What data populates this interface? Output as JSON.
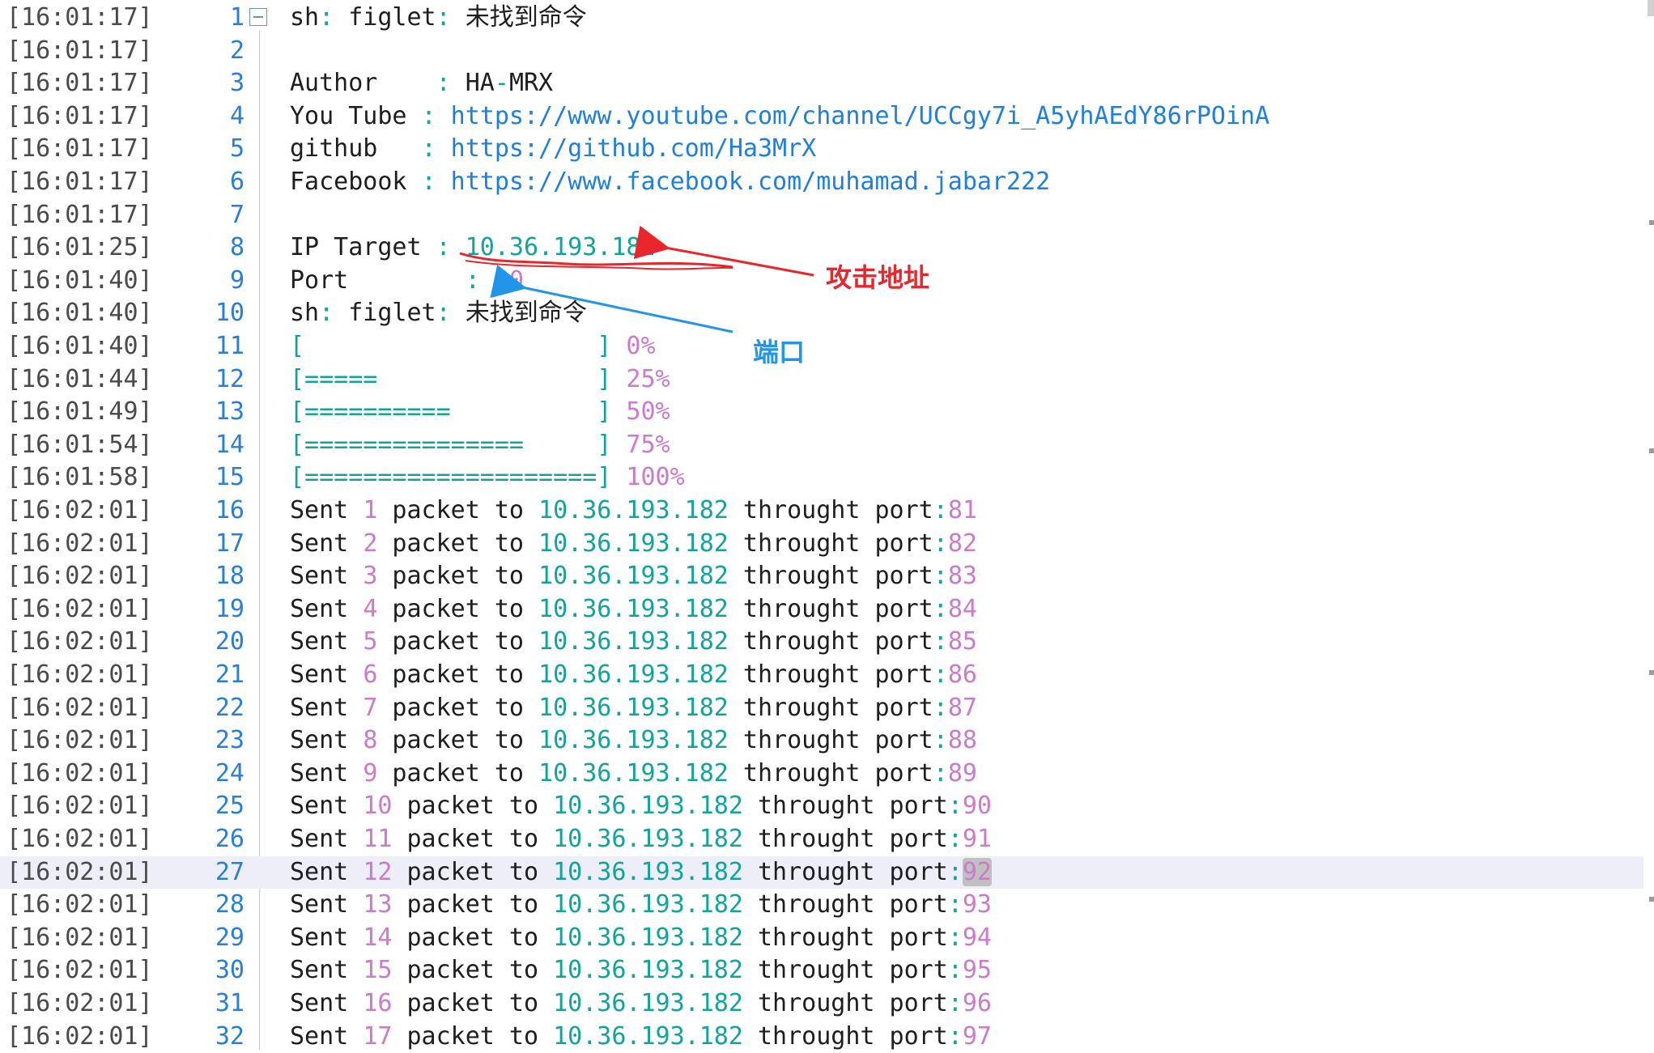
{
  "editor": {
    "lines": [
      {
        "ts": "[16:01:17]",
        "no": "1",
        "parts": [
          {
            "t": "sh",
            "c": ""
          },
          {
            "t": ":",
            "c": "punct"
          },
          {
            "t": " figlet",
            "c": ""
          },
          {
            "t": ":",
            "c": "punct"
          },
          {
            "t": " 未找到命令",
            "c": ""
          }
        ]
      },
      {
        "ts": "[16:01:17]",
        "no": "2",
        "parts": []
      },
      {
        "ts": "[16:01:17]",
        "no": "3",
        "parts": [
          {
            "t": "Author   ",
            "c": ""
          },
          {
            "t": " :",
            "c": "punct"
          },
          {
            "t": " HA",
            "c": ""
          },
          {
            "t": "-",
            "c": "punct"
          },
          {
            "t": "MRX",
            "c": ""
          }
        ]
      },
      {
        "ts": "[16:01:17]",
        "no": "4",
        "parts": [
          {
            "t": "You Tube ",
            "c": ""
          },
          {
            "t": ":",
            "c": "punct"
          },
          {
            "t": " https://www.youtube.com/channel/UCCgy7i_A5yhAEdY86rPOinA",
            "c": "link"
          }
        ]
      },
      {
        "ts": "[16:01:17]",
        "no": "5",
        "parts": [
          {
            "t": "github   ",
            "c": ""
          },
          {
            "t": ":",
            "c": "punct"
          },
          {
            "t": " https://github.com/Ha3MrX",
            "c": "link"
          }
        ]
      },
      {
        "ts": "[16:01:17]",
        "no": "6",
        "parts": [
          {
            "t": "Facebook ",
            "c": ""
          },
          {
            "t": ":",
            "c": "punct"
          },
          {
            "t": " https://www.facebook.com/muhamad.jabar222",
            "c": "link"
          }
        ]
      },
      {
        "ts": "[16:01:17]",
        "no": "7",
        "parts": []
      },
      {
        "ts": "[16:01:25]",
        "no": "8",
        "parts": [
          {
            "t": "IP Target ",
            "c": ""
          },
          {
            "t": ":",
            "c": "punct"
          },
          {
            "t": " 10.36.193.182",
            "c": "ip"
          }
        ]
      },
      {
        "ts": "[16:01:40]",
        "no": "9",
        "parts": [
          {
            "t": "Port        ",
            "c": ""
          },
          {
            "t": ":",
            "c": "punct"
          },
          {
            "t": " 80",
            "c": "num"
          }
        ]
      },
      {
        "ts": "[16:01:40]",
        "no": "10",
        "parts": [
          {
            "t": "sh",
            "c": ""
          },
          {
            "t": ":",
            "c": "punct"
          },
          {
            "t": " figlet",
            "c": ""
          },
          {
            "t": ":",
            "c": "punct"
          },
          {
            "t": " 未找到命令",
            "c": ""
          }
        ]
      },
      {
        "ts": "[16:01:40]",
        "no": "11",
        "parts": [
          {
            "t": "[                    ]",
            "c": "bracket"
          },
          {
            "t": " 0%",
            "c": "num"
          }
        ]
      },
      {
        "ts": "[16:01:44]",
        "no": "12",
        "parts": [
          {
            "t": "[=====               ]",
            "c": "bracket"
          },
          {
            "t": " 25%",
            "c": "num"
          }
        ]
      },
      {
        "ts": "[16:01:49]",
        "no": "13",
        "parts": [
          {
            "t": "[==========          ]",
            "c": "bracket"
          },
          {
            "t": " 50%",
            "c": "num"
          }
        ]
      },
      {
        "ts": "[16:01:54]",
        "no": "14",
        "parts": [
          {
            "t": "[===============     ]",
            "c": "bracket"
          },
          {
            "t": " 75%",
            "c": "num"
          }
        ]
      },
      {
        "ts": "[16:01:58]",
        "no": "15",
        "parts": [
          {
            "t": "[====================]",
            "c": "bracket"
          },
          {
            "t": " 100%",
            "c": "num"
          }
        ]
      },
      {
        "ts": "[16:02:01]",
        "no": "16",
        "parts": [
          {
            "t": "Sent ",
            "c": ""
          },
          {
            "t": "1",
            "c": "num"
          },
          {
            "t": " packet to ",
            "c": ""
          },
          {
            "t": "10.36.193.182",
            "c": "ip"
          },
          {
            "t": " throught port",
            "c": ""
          },
          {
            "t": ":",
            "c": "punct"
          },
          {
            "t": "81",
            "c": "num"
          }
        ]
      },
      {
        "ts": "[16:02:01]",
        "no": "17",
        "parts": [
          {
            "t": "Sent ",
            "c": ""
          },
          {
            "t": "2",
            "c": "num"
          },
          {
            "t": " packet to ",
            "c": ""
          },
          {
            "t": "10.36.193.182",
            "c": "ip"
          },
          {
            "t": " throught port",
            "c": ""
          },
          {
            "t": ":",
            "c": "punct"
          },
          {
            "t": "82",
            "c": "num"
          }
        ]
      },
      {
        "ts": "[16:02:01]",
        "no": "18",
        "parts": [
          {
            "t": "Sent ",
            "c": ""
          },
          {
            "t": "3",
            "c": "num"
          },
          {
            "t": " packet to ",
            "c": ""
          },
          {
            "t": "10.36.193.182",
            "c": "ip"
          },
          {
            "t": " throught port",
            "c": ""
          },
          {
            "t": ":",
            "c": "punct"
          },
          {
            "t": "83",
            "c": "num"
          }
        ]
      },
      {
        "ts": "[16:02:01]",
        "no": "19",
        "parts": [
          {
            "t": "Sent ",
            "c": ""
          },
          {
            "t": "4",
            "c": "num"
          },
          {
            "t": " packet to ",
            "c": ""
          },
          {
            "t": "10.36.193.182",
            "c": "ip"
          },
          {
            "t": " throught port",
            "c": ""
          },
          {
            "t": ":",
            "c": "punct"
          },
          {
            "t": "84",
            "c": "num"
          }
        ]
      },
      {
        "ts": "[16:02:01]",
        "no": "20",
        "parts": [
          {
            "t": "Sent ",
            "c": ""
          },
          {
            "t": "5",
            "c": "num"
          },
          {
            "t": " packet to ",
            "c": ""
          },
          {
            "t": "10.36.193.182",
            "c": "ip"
          },
          {
            "t": " throught port",
            "c": ""
          },
          {
            "t": ":",
            "c": "punct"
          },
          {
            "t": "85",
            "c": "num"
          }
        ]
      },
      {
        "ts": "[16:02:01]",
        "no": "21",
        "parts": [
          {
            "t": "Sent ",
            "c": ""
          },
          {
            "t": "6",
            "c": "num"
          },
          {
            "t": " packet to ",
            "c": ""
          },
          {
            "t": "10.36.193.182",
            "c": "ip"
          },
          {
            "t": " throught port",
            "c": ""
          },
          {
            "t": ":",
            "c": "punct"
          },
          {
            "t": "86",
            "c": "num"
          }
        ]
      },
      {
        "ts": "[16:02:01]",
        "no": "22",
        "parts": [
          {
            "t": "Sent ",
            "c": ""
          },
          {
            "t": "7",
            "c": "num"
          },
          {
            "t": " packet to ",
            "c": ""
          },
          {
            "t": "10.36.193.182",
            "c": "ip"
          },
          {
            "t": " throught port",
            "c": ""
          },
          {
            "t": ":",
            "c": "punct"
          },
          {
            "t": "87",
            "c": "num"
          }
        ]
      },
      {
        "ts": "[16:02:01]",
        "no": "23",
        "parts": [
          {
            "t": "Sent ",
            "c": ""
          },
          {
            "t": "8",
            "c": "num"
          },
          {
            "t": " packet to ",
            "c": ""
          },
          {
            "t": "10.36.193.182",
            "c": "ip"
          },
          {
            "t": " throught port",
            "c": ""
          },
          {
            "t": ":",
            "c": "punct"
          },
          {
            "t": "88",
            "c": "num"
          }
        ]
      },
      {
        "ts": "[16:02:01]",
        "no": "24",
        "parts": [
          {
            "t": "Sent ",
            "c": ""
          },
          {
            "t": "9",
            "c": "num"
          },
          {
            "t": " packet to ",
            "c": ""
          },
          {
            "t": "10.36.193.182",
            "c": "ip"
          },
          {
            "t": " throught port",
            "c": ""
          },
          {
            "t": ":",
            "c": "punct"
          },
          {
            "t": "89",
            "c": "num"
          }
        ]
      },
      {
        "ts": "[16:02:01]",
        "no": "25",
        "parts": [
          {
            "t": "Sent ",
            "c": ""
          },
          {
            "t": "10",
            "c": "num"
          },
          {
            "t": " packet to ",
            "c": ""
          },
          {
            "t": "10.36.193.182",
            "c": "ip"
          },
          {
            "t": " throught port",
            "c": ""
          },
          {
            "t": ":",
            "c": "punct"
          },
          {
            "t": "90",
            "c": "num"
          }
        ]
      },
      {
        "ts": "[16:02:01]",
        "no": "26",
        "parts": [
          {
            "t": "Sent ",
            "c": ""
          },
          {
            "t": "11",
            "c": "num"
          },
          {
            "t": " packet to ",
            "c": ""
          },
          {
            "t": "10.36.193.182",
            "c": "ip"
          },
          {
            "t": " throught port",
            "c": ""
          },
          {
            "t": ":",
            "c": "punct"
          },
          {
            "t": "91",
            "c": "num"
          }
        ]
      },
      {
        "ts": "[16:02:01]",
        "no": "27",
        "current": true,
        "parts": [
          {
            "t": "Sent ",
            "c": ""
          },
          {
            "t": "12",
            "c": "num"
          },
          {
            "t": " packet to ",
            "c": ""
          },
          {
            "t": "10.36.193.182",
            "c": "ip"
          },
          {
            "t": " throught port",
            "c": ""
          },
          {
            "t": ":",
            "c": "punct"
          },
          {
            "t": "92",
            "c": "cursor"
          }
        ]
      },
      {
        "ts": "[16:02:01]",
        "no": "28",
        "parts": [
          {
            "t": "Sent ",
            "c": ""
          },
          {
            "t": "13",
            "c": "num"
          },
          {
            "t": " packet to ",
            "c": ""
          },
          {
            "t": "10.36.193.182",
            "c": "ip"
          },
          {
            "t": " throught port",
            "c": ""
          },
          {
            "t": ":",
            "c": "punct"
          },
          {
            "t": "93",
            "c": "num"
          }
        ]
      },
      {
        "ts": "[16:02:01]",
        "no": "29",
        "parts": [
          {
            "t": "Sent ",
            "c": ""
          },
          {
            "t": "14",
            "c": "num"
          },
          {
            "t": " packet to ",
            "c": ""
          },
          {
            "t": "10.36.193.182",
            "c": "ip"
          },
          {
            "t": " throught port",
            "c": ""
          },
          {
            "t": ":",
            "c": "punct"
          },
          {
            "t": "94",
            "c": "num"
          }
        ]
      },
      {
        "ts": "[16:02:01]",
        "no": "30",
        "parts": [
          {
            "t": "Sent ",
            "c": ""
          },
          {
            "t": "15",
            "c": "num"
          },
          {
            "t": " packet to ",
            "c": ""
          },
          {
            "t": "10.36.193.182",
            "c": "ip"
          },
          {
            "t": " throught port",
            "c": ""
          },
          {
            "t": ":",
            "c": "punct"
          },
          {
            "t": "95",
            "c": "num"
          }
        ]
      },
      {
        "ts": "[16:02:01]",
        "no": "31",
        "parts": [
          {
            "t": "Sent ",
            "c": ""
          },
          {
            "t": "16",
            "c": "num"
          },
          {
            "t": " packet to ",
            "c": ""
          },
          {
            "t": "10.36.193.182",
            "c": "ip"
          },
          {
            "t": " throught port",
            "c": ""
          },
          {
            "t": ":",
            "c": "punct"
          },
          {
            "t": "96",
            "c": "num"
          }
        ]
      },
      {
        "ts": "[16:02:01]",
        "no": "32",
        "parts": [
          {
            "t": "Sent ",
            "c": ""
          },
          {
            "t": "17",
            "c": "num"
          },
          {
            "t": " packet to ",
            "c": ""
          },
          {
            "t": "10.36.193.182",
            "c": "ip"
          },
          {
            "t": " throught port",
            "c": ""
          },
          {
            "t": ":",
            "c": "punct"
          },
          {
            "t": "97",
            "c": "num"
          }
        ]
      }
    ]
  },
  "annotations": {
    "attack_label": "攻击地址",
    "port_label": "端口",
    "attack_color": "#e8262c",
    "port_color": "#2196e8"
  },
  "colors": {
    "link": "#1e7fdc",
    "ip": "#14a39a",
    "number": "#cc7acc",
    "line_number": "#2a7fd4",
    "current_line_bg": "#eeeef8"
  },
  "icons": {
    "fold": "fold-minus-icon"
  }
}
